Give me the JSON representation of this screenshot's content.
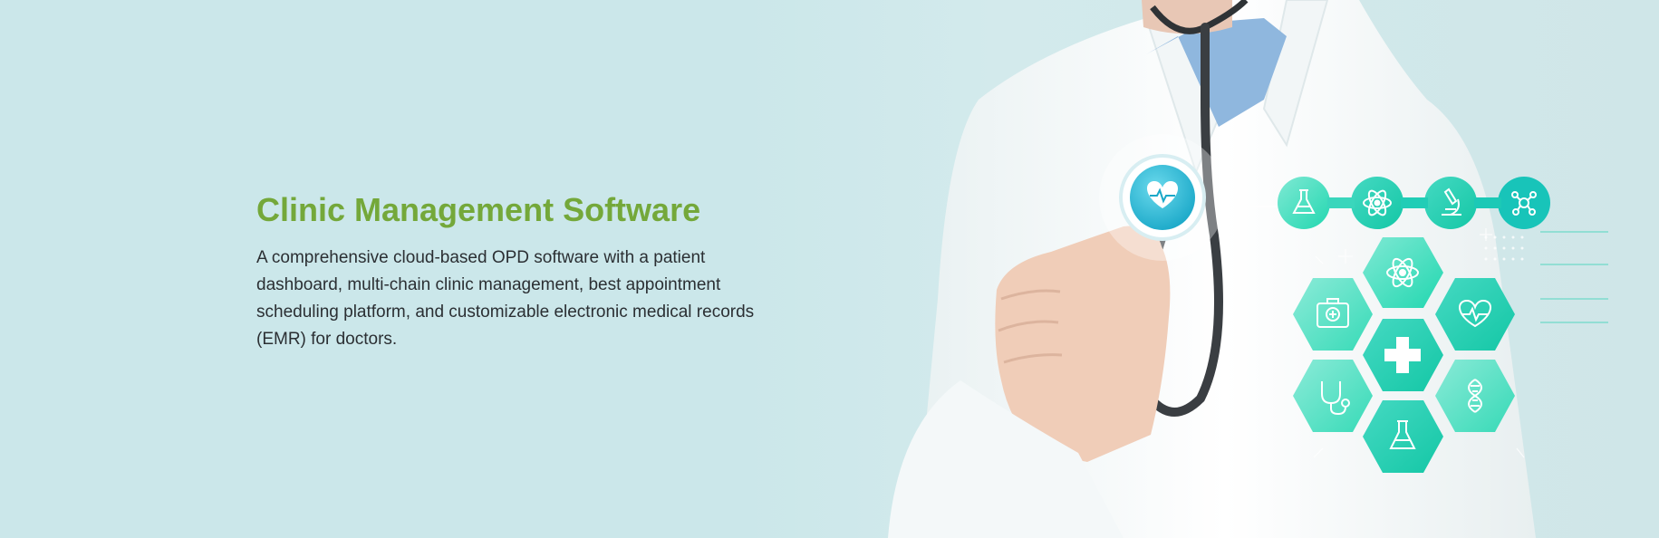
{
  "hero": {
    "title": "Clinic Management Software",
    "description": "A comprehensive cloud-based OPD software with a patient dashboard, multi-chain clinic management, best appointment scheduling platform, and customizable electronic medical records (EMR) for doctors."
  },
  "colors": {
    "title": "#74a83a",
    "background": "#cbe7ea",
    "body_text": "#2b2f33",
    "accent": "#2fd3b5",
    "teal": "#1dbfd6"
  },
  "icons": [
    "heart-pulse-icon",
    "flask-icon",
    "atom-icon",
    "microscope-icon",
    "molecule-icon",
    "medical-kit-icon",
    "heart-rate-icon",
    "medical-cross-icon",
    "stethoscope-icon",
    "dna-icon"
  ]
}
